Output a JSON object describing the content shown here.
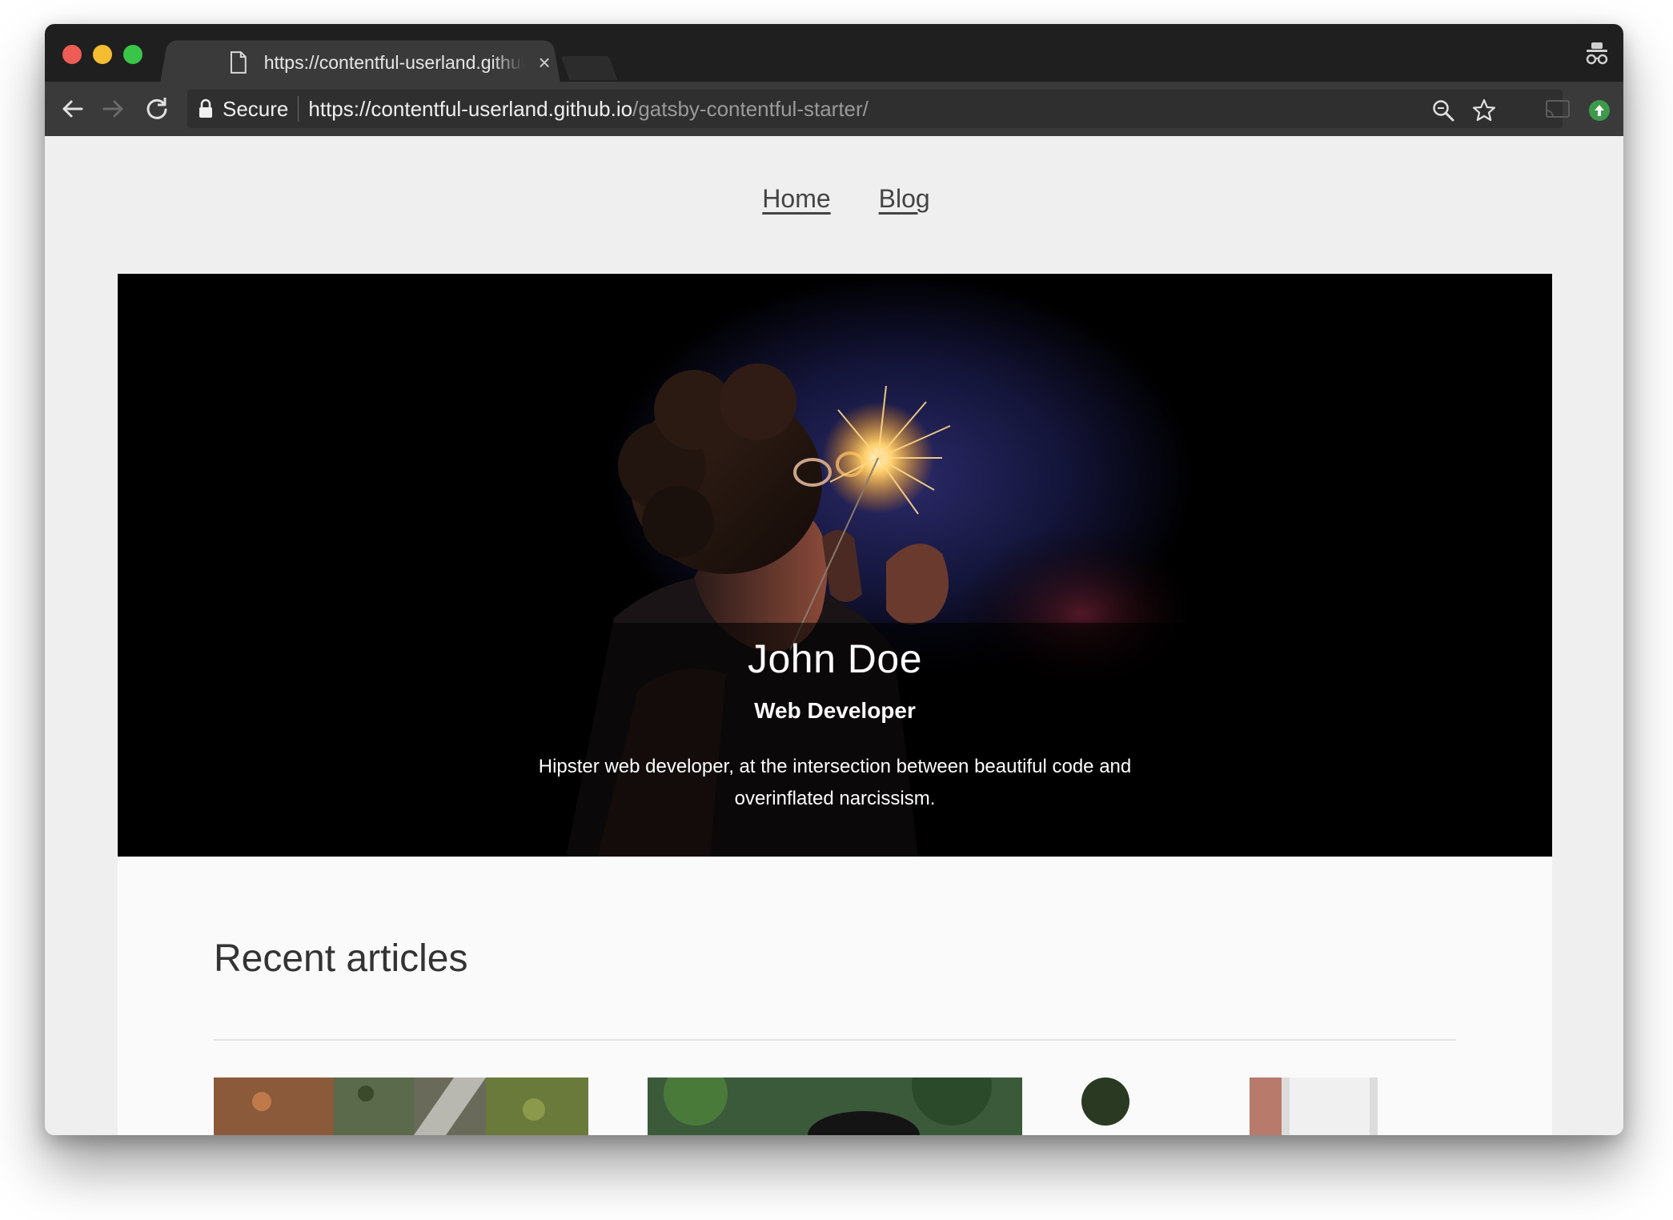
{
  "browser": {
    "tab": {
      "title": "https://contentful-userland.github.io",
      "close_label": "×"
    },
    "address_bar": {
      "security_label": "Secure",
      "url_origin": "https://contentful-userland.github.io",
      "url_path": "/gatsby-contentful-starter/"
    }
  },
  "site": {
    "nav": {
      "home_label": "Home",
      "blog_label": "Blog"
    },
    "hero": {
      "name": "John Doe",
      "title": "Web Developer",
      "description": "Hipster web developer, at the intersection between beautiful code and overinflated narcissism."
    },
    "articles": {
      "heading": "Recent articles"
    }
  },
  "icons": {
    "tab": "document-icon",
    "incognito": "incognito-icon",
    "back": "arrow-left-icon",
    "forward": "arrow-right-icon",
    "reload": "reload-icon",
    "lock": "lock-icon",
    "zoom": "magnifier-icon",
    "bookmark": "star-icon",
    "cast": "cast-icon",
    "extension": "extension-icon"
  }
}
